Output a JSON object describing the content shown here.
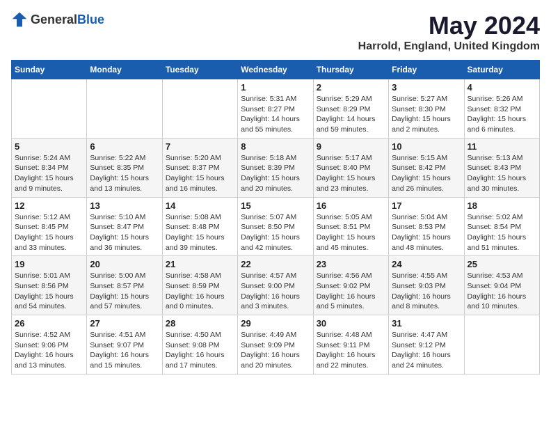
{
  "header": {
    "logo_general": "General",
    "logo_blue": "Blue",
    "month_title": "May 2024",
    "location": "Harrold, England, United Kingdom"
  },
  "weekdays": [
    "Sunday",
    "Monday",
    "Tuesday",
    "Wednesday",
    "Thursday",
    "Friday",
    "Saturday"
  ],
  "weeks": [
    [
      {
        "day": "",
        "info": ""
      },
      {
        "day": "",
        "info": ""
      },
      {
        "day": "",
        "info": ""
      },
      {
        "day": "1",
        "info": "Sunrise: 5:31 AM\nSunset: 8:27 PM\nDaylight: 14 hours\nand 55 minutes."
      },
      {
        "day": "2",
        "info": "Sunrise: 5:29 AM\nSunset: 8:29 PM\nDaylight: 14 hours\nand 59 minutes."
      },
      {
        "day": "3",
        "info": "Sunrise: 5:27 AM\nSunset: 8:30 PM\nDaylight: 15 hours\nand 2 minutes."
      },
      {
        "day": "4",
        "info": "Sunrise: 5:26 AM\nSunset: 8:32 PM\nDaylight: 15 hours\nand 6 minutes."
      }
    ],
    [
      {
        "day": "5",
        "info": "Sunrise: 5:24 AM\nSunset: 8:34 PM\nDaylight: 15 hours\nand 9 minutes."
      },
      {
        "day": "6",
        "info": "Sunrise: 5:22 AM\nSunset: 8:35 PM\nDaylight: 15 hours\nand 13 minutes."
      },
      {
        "day": "7",
        "info": "Sunrise: 5:20 AM\nSunset: 8:37 PM\nDaylight: 15 hours\nand 16 minutes."
      },
      {
        "day": "8",
        "info": "Sunrise: 5:18 AM\nSunset: 8:39 PM\nDaylight: 15 hours\nand 20 minutes."
      },
      {
        "day": "9",
        "info": "Sunrise: 5:17 AM\nSunset: 8:40 PM\nDaylight: 15 hours\nand 23 minutes."
      },
      {
        "day": "10",
        "info": "Sunrise: 5:15 AM\nSunset: 8:42 PM\nDaylight: 15 hours\nand 26 minutes."
      },
      {
        "day": "11",
        "info": "Sunrise: 5:13 AM\nSunset: 8:43 PM\nDaylight: 15 hours\nand 30 minutes."
      }
    ],
    [
      {
        "day": "12",
        "info": "Sunrise: 5:12 AM\nSunset: 8:45 PM\nDaylight: 15 hours\nand 33 minutes."
      },
      {
        "day": "13",
        "info": "Sunrise: 5:10 AM\nSunset: 8:47 PM\nDaylight: 15 hours\nand 36 minutes."
      },
      {
        "day": "14",
        "info": "Sunrise: 5:08 AM\nSunset: 8:48 PM\nDaylight: 15 hours\nand 39 minutes."
      },
      {
        "day": "15",
        "info": "Sunrise: 5:07 AM\nSunset: 8:50 PM\nDaylight: 15 hours\nand 42 minutes."
      },
      {
        "day": "16",
        "info": "Sunrise: 5:05 AM\nSunset: 8:51 PM\nDaylight: 15 hours\nand 45 minutes."
      },
      {
        "day": "17",
        "info": "Sunrise: 5:04 AM\nSunset: 8:53 PM\nDaylight: 15 hours\nand 48 minutes."
      },
      {
        "day": "18",
        "info": "Sunrise: 5:02 AM\nSunset: 8:54 PM\nDaylight: 15 hours\nand 51 minutes."
      }
    ],
    [
      {
        "day": "19",
        "info": "Sunrise: 5:01 AM\nSunset: 8:56 PM\nDaylight: 15 hours\nand 54 minutes."
      },
      {
        "day": "20",
        "info": "Sunrise: 5:00 AM\nSunset: 8:57 PM\nDaylight: 15 hours\nand 57 minutes."
      },
      {
        "day": "21",
        "info": "Sunrise: 4:58 AM\nSunset: 8:59 PM\nDaylight: 16 hours\nand 0 minutes."
      },
      {
        "day": "22",
        "info": "Sunrise: 4:57 AM\nSunset: 9:00 PM\nDaylight: 16 hours\nand 3 minutes."
      },
      {
        "day": "23",
        "info": "Sunrise: 4:56 AM\nSunset: 9:02 PM\nDaylight: 16 hours\nand 5 minutes."
      },
      {
        "day": "24",
        "info": "Sunrise: 4:55 AM\nSunset: 9:03 PM\nDaylight: 16 hours\nand 8 minutes."
      },
      {
        "day": "25",
        "info": "Sunrise: 4:53 AM\nSunset: 9:04 PM\nDaylight: 16 hours\nand 10 minutes."
      }
    ],
    [
      {
        "day": "26",
        "info": "Sunrise: 4:52 AM\nSunset: 9:06 PM\nDaylight: 16 hours\nand 13 minutes."
      },
      {
        "day": "27",
        "info": "Sunrise: 4:51 AM\nSunset: 9:07 PM\nDaylight: 16 hours\nand 15 minutes."
      },
      {
        "day": "28",
        "info": "Sunrise: 4:50 AM\nSunset: 9:08 PM\nDaylight: 16 hours\nand 17 minutes."
      },
      {
        "day": "29",
        "info": "Sunrise: 4:49 AM\nSunset: 9:09 PM\nDaylight: 16 hours\nand 20 minutes."
      },
      {
        "day": "30",
        "info": "Sunrise: 4:48 AM\nSunset: 9:11 PM\nDaylight: 16 hours\nand 22 minutes."
      },
      {
        "day": "31",
        "info": "Sunrise: 4:47 AM\nSunset: 9:12 PM\nDaylight: 16 hours\nand 24 minutes."
      },
      {
        "day": "",
        "info": ""
      }
    ]
  ]
}
